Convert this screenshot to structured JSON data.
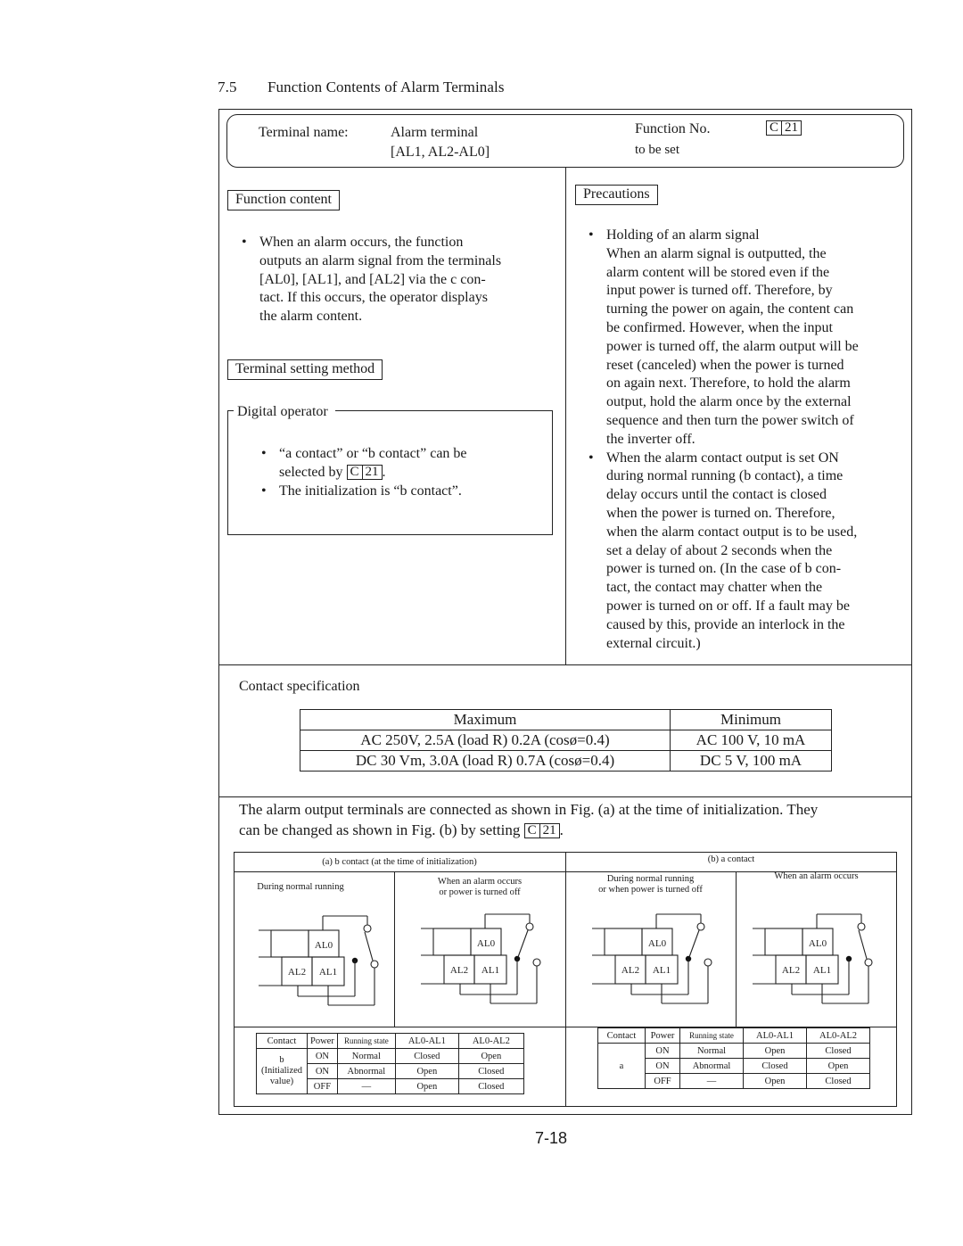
{
  "section": {
    "number": "7.5",
    "title": "Function Contents of Alarm Terminals"
  },
  "header": {
    "terminal_name_label": "Terminal name:",
    "terminal_name_line1": "Alarm terminal",
    "terminal_name_line2": "[AL1, AL2-AL0]",
    "function_no_label_line1": "Function No.",
    "function_no_label_line2": "to be set",
    "function_code": {
      "letter": "C",
      "number": "21"
    }
  },
  "function_content": {
    "label": "Function content",
    "bullets": [
      [
        "When an alarm occurs, the function",
        "outputs an alarm signal from the terminals",
        "[AL0], [AL1], and [AL2] via the c con-",
        "tact.  If this occurs, the operator displays",
        "the alarm content."
      ]
    ]
  },
  "terminal_setting": {
    "label": "Terminal setting method",
    "group_label": "Digital operator",
    "bullet1_line1": "“a contact” or “b contact” can be",
    "bullet1_line2_prefix": "selected by",
    "bullet1_line2_suffix": ".",
    "bullet2": "The initialization is “b contact”."
  },
  "precautions": {
    "label": "Precautions",
    "bullets": [
      [
        "Holding of an alarm signal",
        "When an alarm signal is outputted, the",
        "alarm content will be stored even if the",
        "input power is turned off.  Therefore, by",
        "turning the power on again, the content can",
        "be confirmed.  However, when the input",
        "power is turned off, the alarm output will be",
        "reset (canceled) when the power is turned",
        "on again next.  Therefore, to hold the alarm",
        "output, hold the alarm once by the external",
        "sequence and then turn the power switch of",
        "the inverter off."
      ],
      [
        "When the alarm contact output is set ON",
        "during normal running (b contact), a time",
        "delay occurs until the contact is closed",
        "when the power is turned on.  Therefore,",
        "when the alarm contact output is to be used,",
        "set a delay of about 2 seconds when the",
        "power is turned on.  (In the case of b con-",
        "tact, the contact may chatter when the",
        "power is turned on or off.  If a fault may be",
        "caused by this, provide an interlock in the",
        "external circuit.)"
      ]
    ]
  },
  "contact_spec": {
    "title": "Contact specification",
    "headers": [
      "Maximum",
      "Minimum"
    ],
    "rows": [
      [
        "AC 250V, 2.5A (load R) 0.2A (cosø=0.4)",
        "AC 100 V, 10 mA"
      ],
      [
        "DC 30 Vm, 3.0A (load R) 0.7A (cosø=0.4)",
        "DC 5 V, 100 mA"
      ]
    ]
  },
  "connection_note": {
    "line1": "The alarm output terminals are connected as shown in Fig. (a) at the time of initialization.  They",
    "line2_prefix": "can be changed as shown in Fig. (b) by setting",
    "line2_suffix": "."
  },
  "figures": {
    "a": {
      "title": "(a) b contact (at the time of initialization)",
      "panels": [
        {
          "caption_line1": "During normal running",
          "caption_line2": ""
        },
        {
          "caption_line1": "When an alarm occurs",
          "caption_line2": "or power is turned off"
        }
      ],
      "table": {
        "headers": [
          "Contact",
          "Power",
          "Running state",
          "AL0-AL1",
          "AL0-AL2"
        ],
        "contact_label_lines": [
          "b",
          "(Initialized",
          "value)"
        ],
        "rows": [
          [
            "ON",
            "Normal",
            "Closed",
            "Open"
          ],
          [
            "ON",
            "Abnormal",
            "Open",
            "Closed"
          ],
          [
            "OFF",
            "—",
            "Open",
            "Closed"
          ]
        ]
      }
    },
    "b": {
      "title": "(b) a contact",
      "panels": [
        {
          "caption_line1": "During normal running",
          "caption_line2": "or when power is turned off"
        },
        {
          "caption_line1": "When an alarm occurs",
          "caption_line2": ""
        }
      ],
      "table": {
        "headers": [
          "Contact",
          "Power",
          "Running state",
          "AL0-AL1",
          "AL0-AL2"
        ],
        "contact_label_lines": [
          "a"
        ],
        "rows": [
          [
            "ON",
            "Normal",
            "Open",
            "Closed"
          ],
          [
            "ON",
            "Abnormal",
            "Closed",
            "Open"
          ],
          [
            "OFF",
            "—",
            "Open",
            "Closed"
          ]
        ]
      }
    },
    "terminal_labels": {
      "al0": "AL0",
      "al1": "AL1",
      "al2": "AL2"
    }
  },
  "page_number": "7-18"
}
